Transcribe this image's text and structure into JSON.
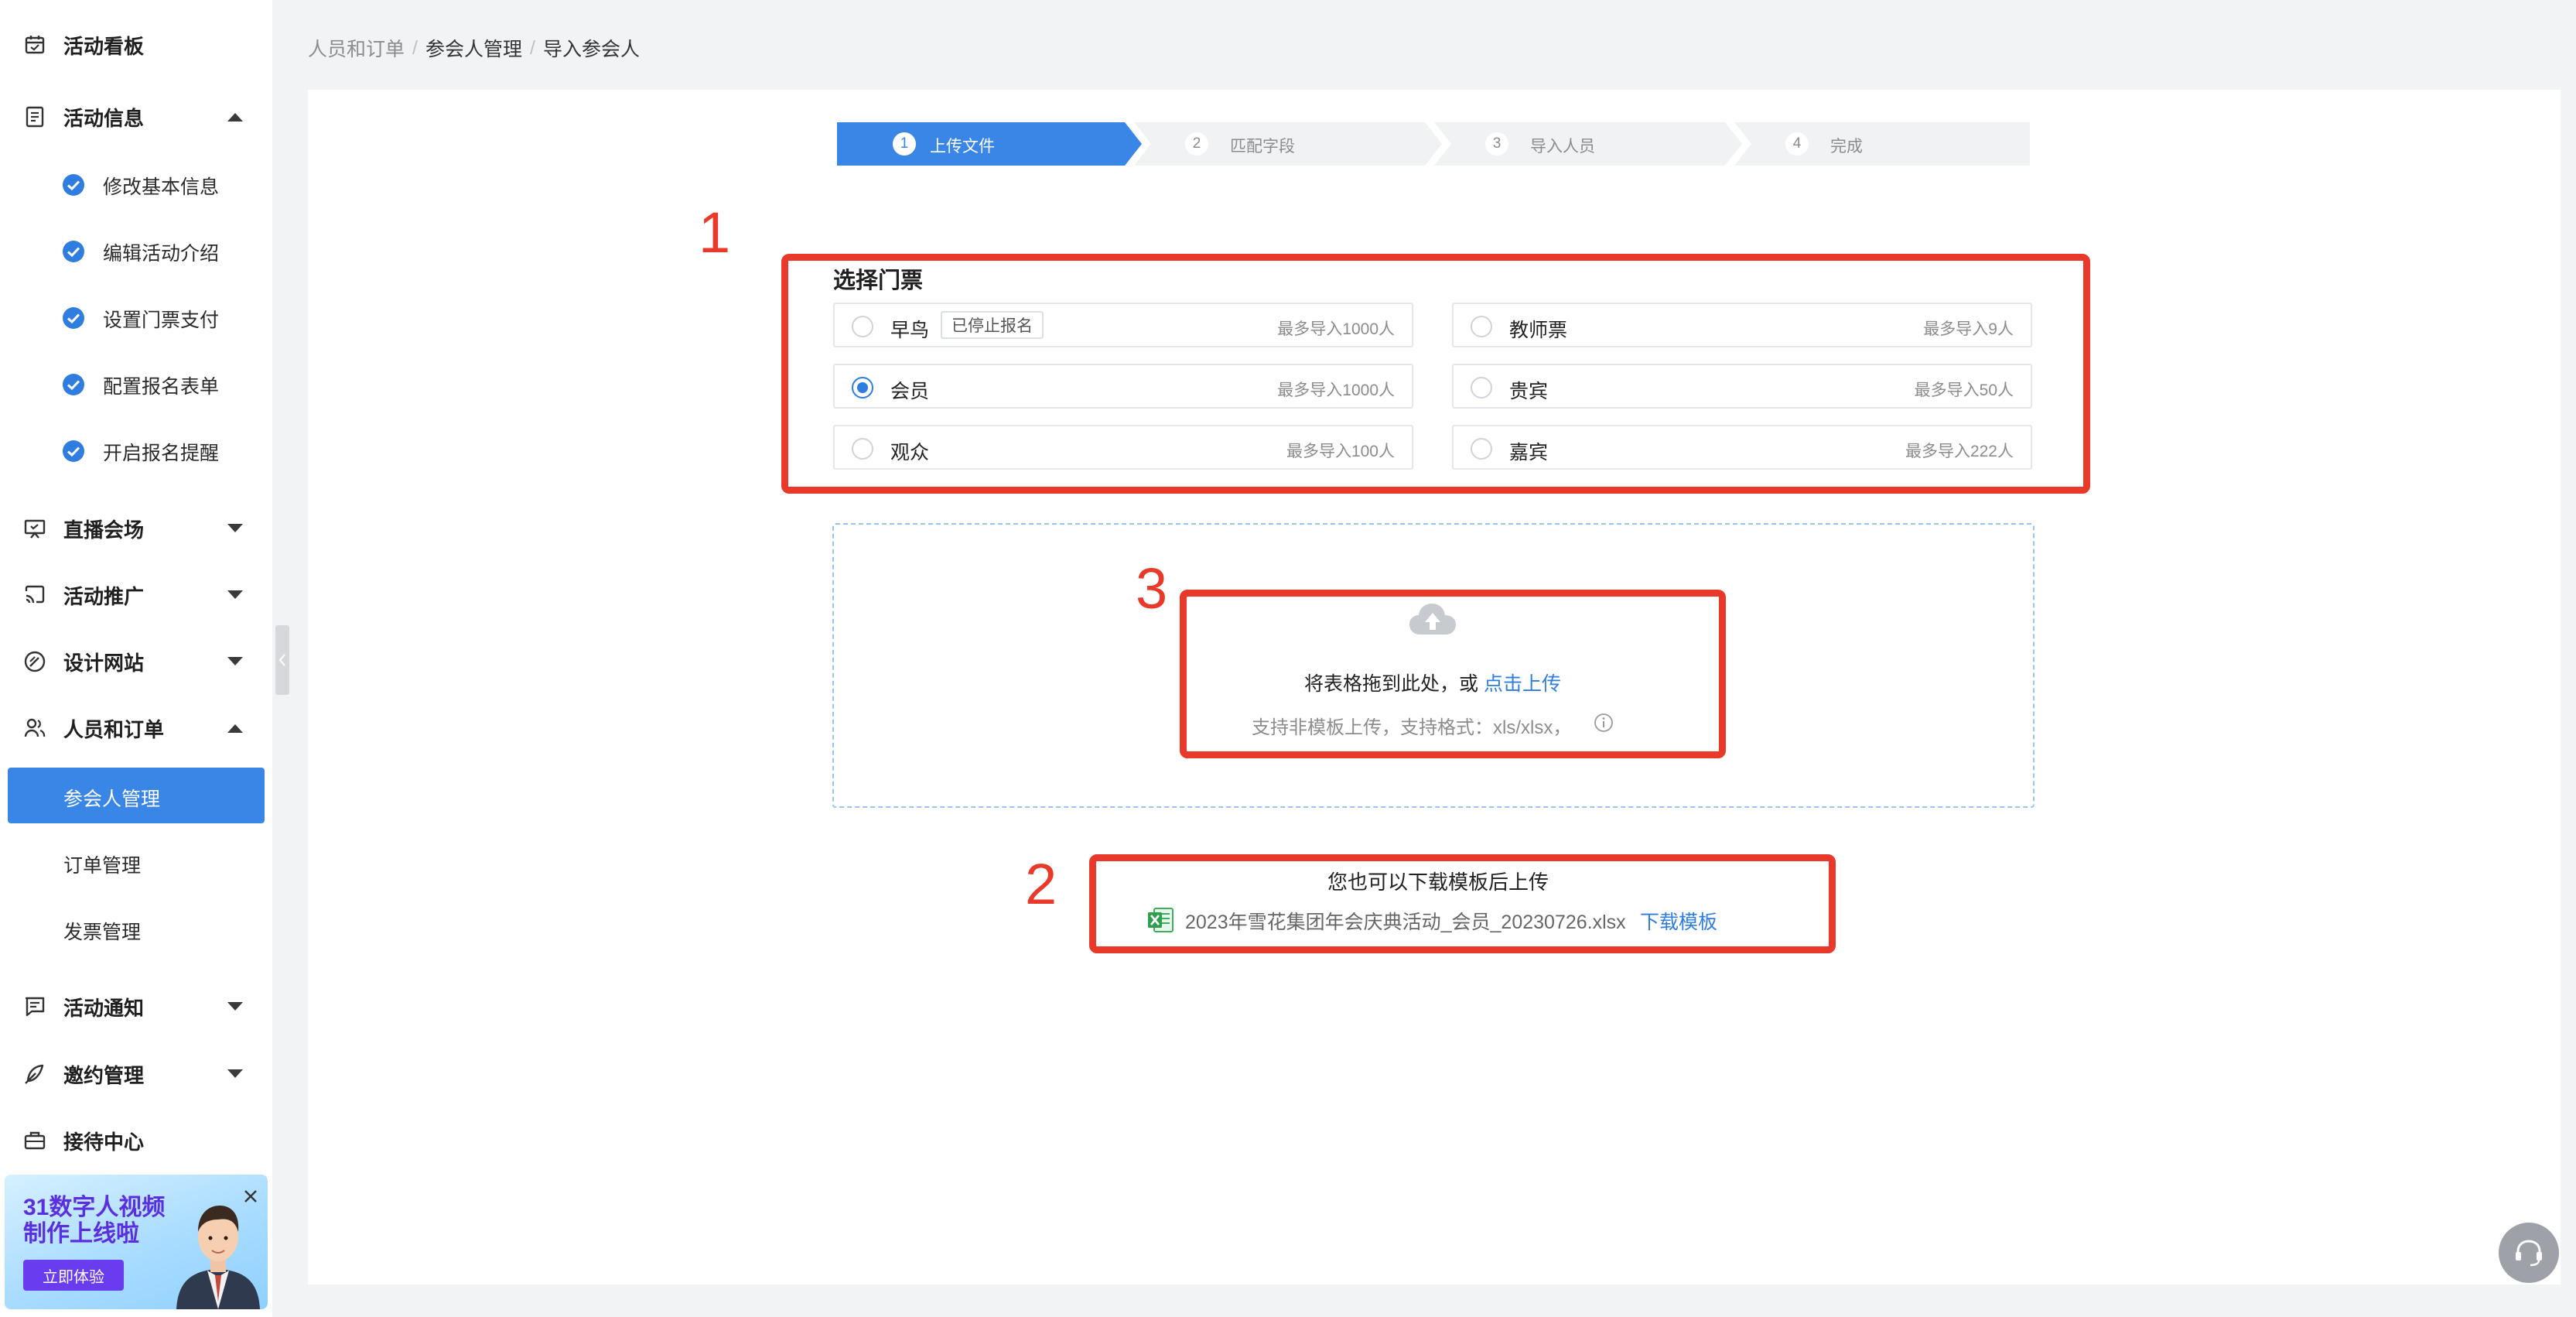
{
  "sidebar": {
    "dashboard": "活动看板",
    "activity_info": {
      "label": "活动信息",
      "children": [
        "修改基本信息",
        "编辑活动介绍",
        "设置门票支付",
        "配置报名表单",
        "开启报名提醒"
      ]
    },
    "live_venue": "直播会场",
    "promotion": "活动推广",
    "design_site": "设计网站",
    "people_orders": {
      "label": "人员和订单",
      "children": [
        "参会人管理",
        "订单管理",
        "发票管理"
      ],
      "active": "参会人管理"
    },
    "notifications": "活动通知",
    "invitations": "邀约管理",
    "reception": "接待中心",
    "promo": {
      "title": "31数字人视频制作上线啦",
      "button": "立即体验"
    }
  },
  "breadcrumb": [
    "人员和订单",
    "参会人管理",
    "导入参会人"
  ],
  "steps": [
    {
      "num": "1",
      "label": "上传文件",
      "active": true
    },
    {
      "num": "2",
      "label": "匹配字段",
      "active": false
    },
    {
      "num": "3",
      "label": "导入人员",
      "active": false
    },
    {
      "num": "4",
      "label": "完成",
      "active": false
    }
  ],
  "ticket_section": {
    "title": "选择门票",
    "tickets": [
      {
        "name": "早鸟",
        "tag": "已停止报名",
        "limit": "最多导入1000人",
        "selected": false
      },
      {
        "name": "教师票",
        "tag": "",
        "limit": "最多导入9人",
        "selected": false
      },
      {
        "name": "会员",
        "tag": "",
        "limit": "最多导入1000人",
        "selected": true
      },
      {
        "name": "贵宾",
        "tag": "",
        "limit": "最多导入50人",
        "selected": false
      },
      {
        "name": "观众",
        "tag": "",
        "limit": "最多导入100人",
        "selected": false
      },
      {
        "name": "嘉宾",
        "tag": "",
        "limit": "最多导入222人",
        "selected": false
      }
    ]
  },
  "upload": {
    "drop_text": "将表格拖到此处，或",
    "click_upload": "点击上传",
    "format_hint": "支持非模板上传，支持格式：xls/xlsx，"
  },
  "template": {
    "hint": "您也可以下载模板后上传",
    "file_name": "2023年雪花集团年会庆典活动_会员_20230726.xlsx",
    "download_label": "下载模板"
  },
  "annotations": [
    "1",
    "2",
    "3"
  ],
  "colors": {
    "accent": "#3a86e6",
    "annotation_red": "#e8392a",
    "step_inactive_bg": "#f1f2f4"
  }
}
